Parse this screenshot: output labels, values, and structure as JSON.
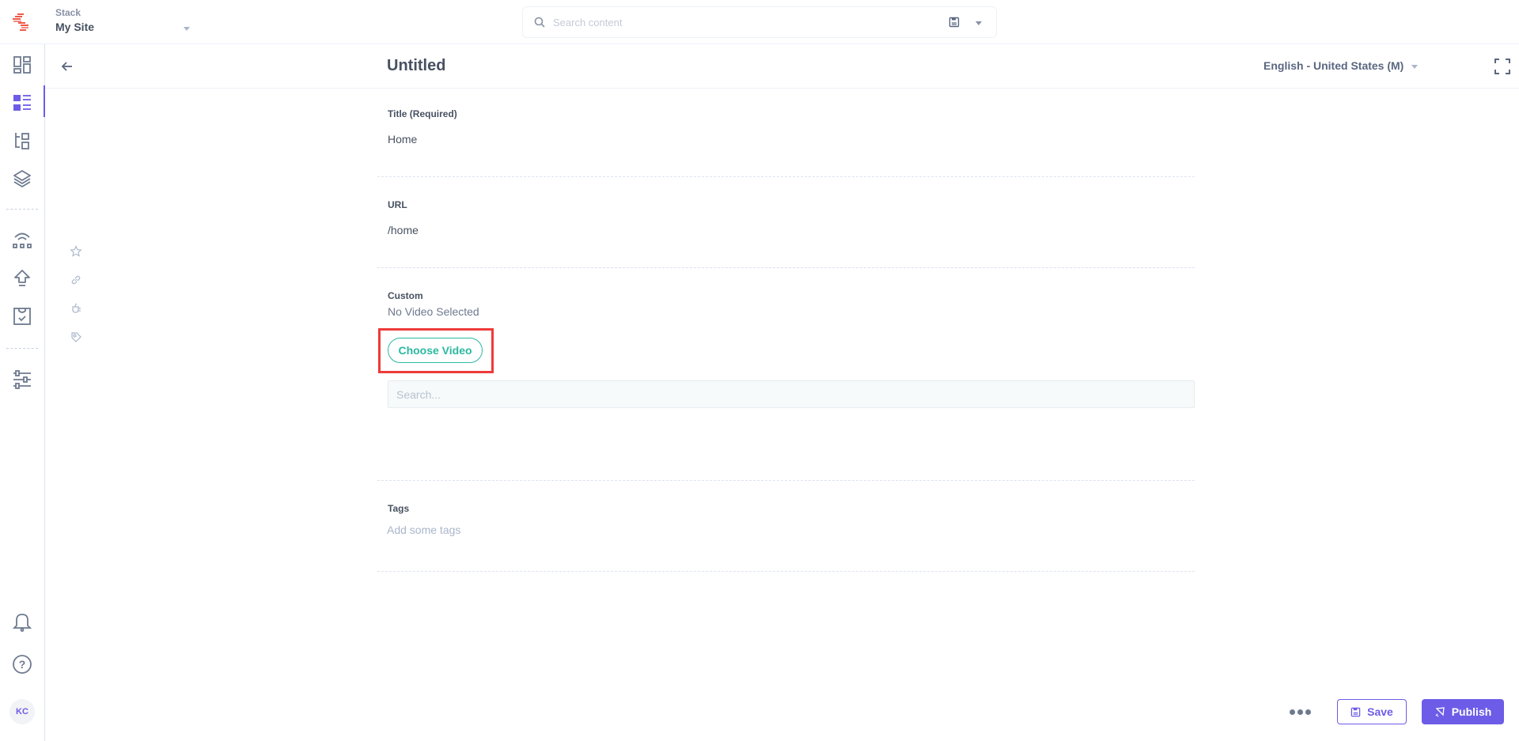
{
  "topbar": {
    "stack_label": "Stack",
    "stack_name": "My Site",
    "search_placeholder": "Search content"
  },
  "leftnav": {
    "items": [
      {
        "name": "dashboard",
        "icon": "dashboard-icon",
        "active": false
      },
      {
        "name": "entries",
        "icon": "entries-list-icon",
        "active": true
      },
      {
        "name": "content-models",
        "icon": "content-model-icon",
        "active": false
      },
      {
        "name": "assets",
        "icon": "layers-icon",
        "active": false
      },
      {
        "name": "releases",
        "icon": "deploy-icon",
        "active": false
      },
      {
        "name": "publish-queue",
        "icon": "upload-arrow-icon",
        "active": false
      },
      {
        "name": "tasks",
        "icon": "clipboard-check-icon",
        "active": false
      },
      {
        "name": "settings",
        "icon": "sliders-icon",
        "active": false
      },
      {
        "name": "notifications",
        "icon": "bell-icon",
        "active": false
      },
      {
        "name": "help",
        "icon": "help-circle-icon",
        "active": false
      }
    ],
    "avatar_initials": "KC"
  },
  "entry": {
    "title": "Untitled",
    "locale": "English - United States (M)"
  },
  "side_tools": [
    "star-icon",
    "link-icon",
    "plug-icon",
    "tag-icon"
  ],
  "fields": {
    "title": {
      "label": "Title (Required)",
      "value": "Home"
    },
    "url": {
      "label": "URL",
      "value": "/home"
    },
    "custom": {
      "label": "Custom",
      "status": "No Video Selected",
      "choose_button": "Choose Video",
      "search_placeholder": "Search..."
    },
    "tags": {
      "label": "Tags",
      "placeholder": "Add some tags"
    }
  },
  "footer": {
    "save_label": "Save",
    "publish_label": "Publish"
  },
  "colors": {
    "accent": "#6c5ce7",
    "teal": "#2bb8a0",
    "highlight": "#ef3a3a"
  }
}
